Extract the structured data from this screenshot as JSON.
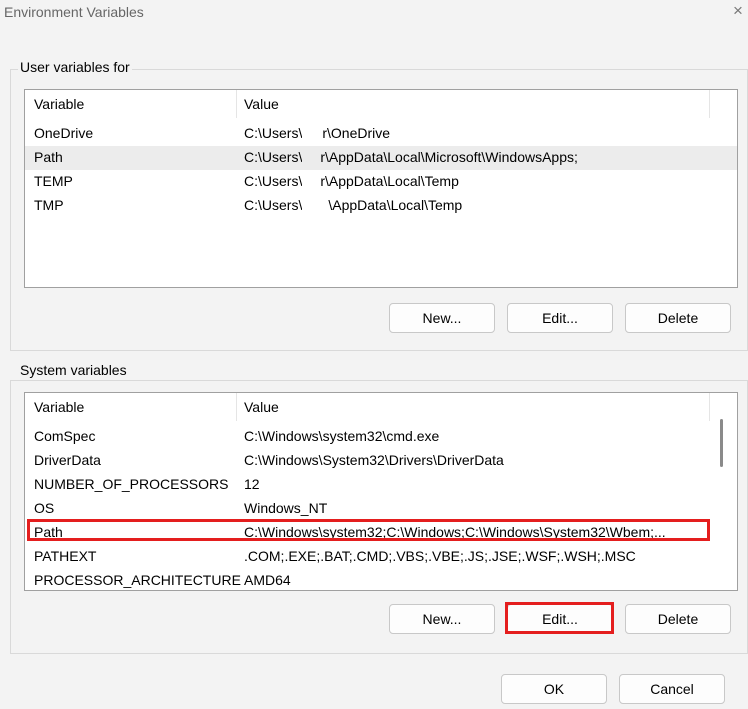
{
  "window": {
    "title": "Environment Variables",
    "close_glyph": "×"
  },
  "user_section": {
    "label": "User variables for",
    "columns": [
      "Variable",
      "Value"
    ],
    "rows": [
      {
        "name": "OneDrive",
        "value_pre": "C:\\Users\\",
        "value_post": "r\\OneDrive"
      },
      {
        "name": "Path",
        "value_pre": "C:\\Users\\",
        "value_post": "r\\AppData\\Local\\Microsoft\\WindowsApps;"
      },
      {
        "name": "TEMP",
        "value_pre": "C:\\Users\\",
        "value_post": "r\\AppData\\Local\\Temp"
      },
      {
        "name": "TMP",
        "value_pre": "C:\\Users\\",
        "value_post": "\\AppData\\Local\\Temp"
      }
    ],
    "selected_row": "Path",
    "buttons": {
      "new": "New...",
      "edit": "Edit...",
      "delete": "Delete"
    }
  },
  "system_section": {
    "label": "System variables",
    "columns": [
      "Variable",
      "Value"
    ],
    "rows": [
      {
        "name": "ComSpec",
        "value": "C:\\Windows\\system32\\cmd.exe"
      },
      {
        "name": "DriverData",
        "value": "C:\\Windows\\System32\\Drivers\\DriverData"
      },
      {
        "name": "NUMBER_OF_PROCESSORS",
        "value": "12"
      },
      {
        "name": "OS",
        "value": "Windows_NT"
      },
      {
        "name": "Path",
        "value": "C:\\Windows\\system32;C:\\Windows;C:\\Windows\\System32\\Wbem;..."
      },
      {
        "name": "PATHEXT",
        "value": ".COM;.EXE;.BAT;.CMD;.VBS;.VBE;.JS;.JSE;.WSF;.WSH;.MSC"
      },
      {
        "name": "PROCESSOR_ARCHITECTURE",
        "value": "AMD64"
      }
    ],
    "highlighted_row": "Path",
    "buttons": {
      "new": "New...",
      "edit": "Edit...",
      "delete": "Delete"
    },
    "highlighted_button": "Edit..."
  },
  "footer": {
    "ok": "OK",
    "cancel": "Cancel"
  },
  "colors": {
    "highlight": "#e41e1e",
    "window_bg": "#f3f3f3",
    "list_bg": "#ffffff",
    "selected_row_bg": "#ececec"
  },
  "icons": {
    "close": "close-icon"
  }
}
